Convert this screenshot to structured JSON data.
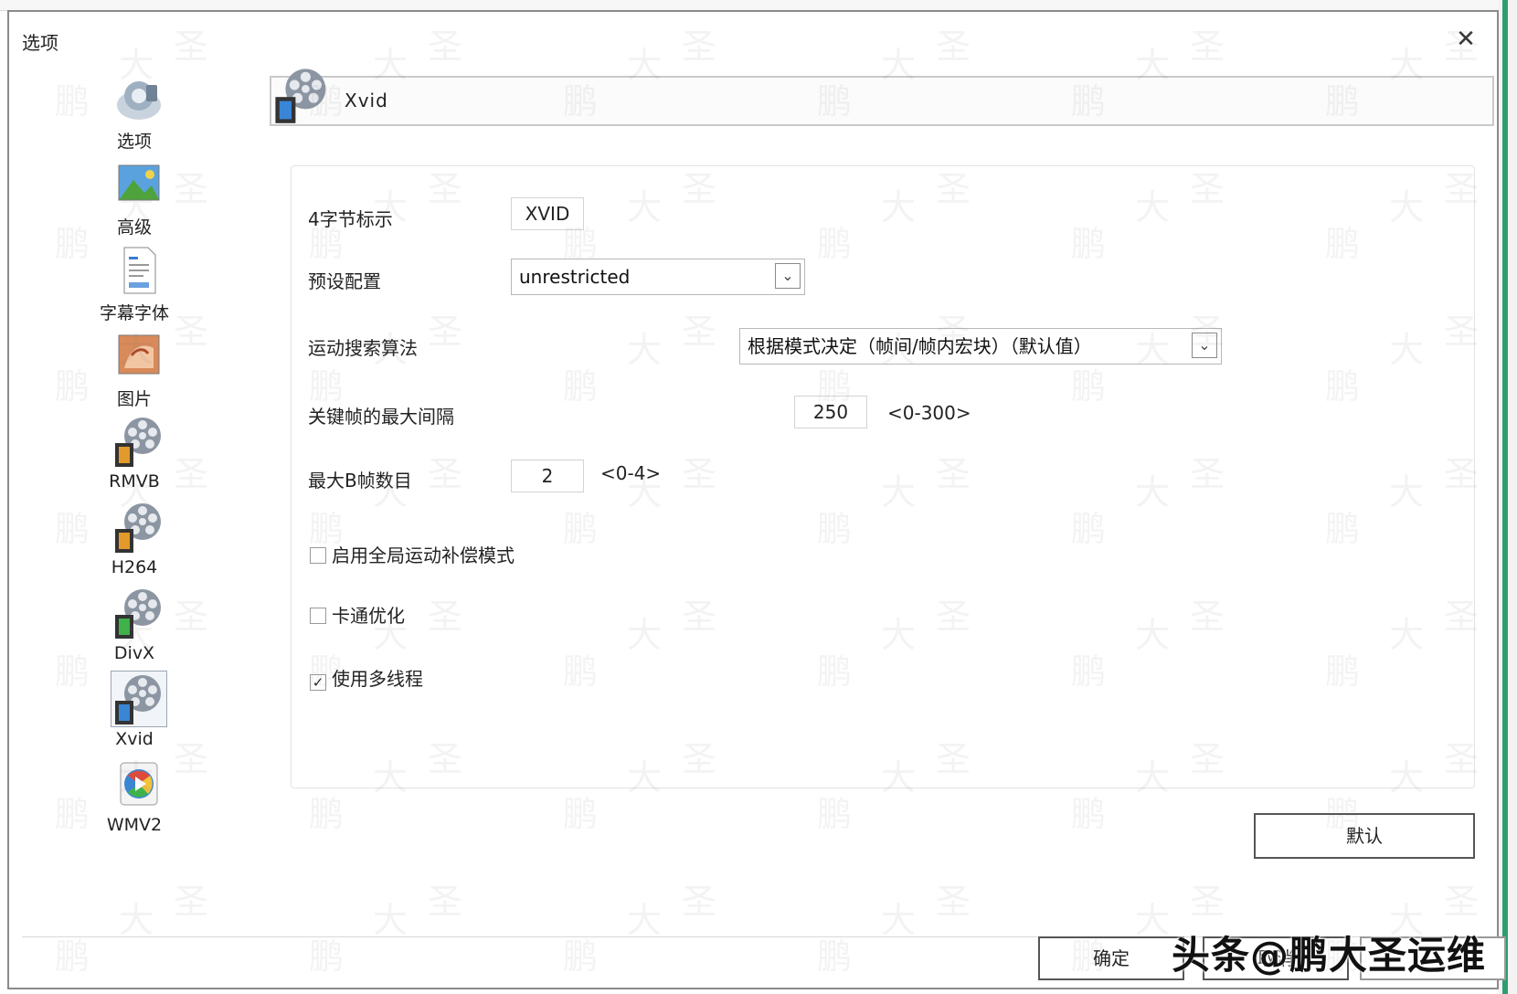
{
  "window": {
    "title": "选项",
    "close": "✕"
  },
  "sidebar": {
    "items": [
      {
        "label": "选项",
        "icon": "options-icon"
      },
      {
        "label": "高级",
        "icon": "advanced-icon"
      },
      {
        "label": "字幕字体",
        "icon": "subtitle-font-icon"
      },
      {
        "label": "图片",
        "icon": "picture-icon"
      },
      {
        "label": "RMVB",
        "icon": "rmvb-film-icon"
      },
      {
        "label": "H264",
        "icon": "h264-film-icon"
      },
      {
        "label": "DivX",
        "icon": "divx-film-icon"
      },
      {
        "label": "Xvid",
        "icon": "xvid-film-icon",
        "selected": true
      },
      {
        "label": "WMV2",
        "icon": "wmv2-media-icon"
      }
    ]
  },
  "header": {
    "title": "Xvid",
    "icon": "xvid-film-icon"
  },
  "form": {
    "fourcc_label": "4字节标示",
    "fourcc_value": "XVID",
    "preset_label": "预设配置",
    "preset_value": "unrestricted",
    "motion_label": "运动搜索算法",
    "motion_value": "根据模式决定（帧间/帧内宏块）（默认值）",
    "keyframe_label": "关键帧的最大间隔",
    "keyframe_value": "250",
    "keyframe_range": "<0-300>",
    "bframes_label": "最大B帧数目",
    "bframes_value": "2",
    "bframes_range": "<0-4>",
    "gmc_label": "启用全局运动补偿模式",
    "gmc_checked": false,
    "cartoon_label": "卡通优化",
    "cartoon_checked": false,
    "multithread_label": "使用多线程",
    "multithread_checked": true
  },
  "buttons": {
    "default": "默认",
    "ok": "确定",
    "cancel": "取消"
  },
  "watermark": {
    "chars": [
      "鹏",
      "大",
      "圣"
    ],
    "brand": "头条@鹏大圣运维"
  },
  "colors": {
    "accent_green": "#2e9d6d",
    "film_orange": "#e39a2a",
    "film_green": "#3fb24a",
    "film_blue": "#3a86d6"
  },
  "check_glyph": "✓",
  "arrow_glyph": "⌄"
}
